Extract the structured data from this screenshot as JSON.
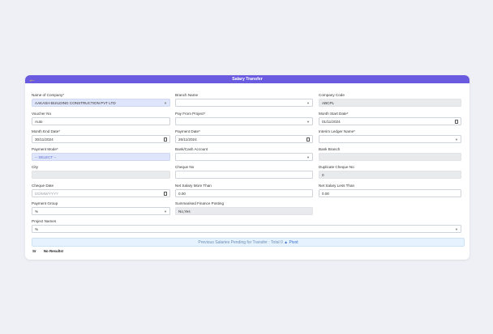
{
  "header": {
    "title": "Salary Transfer",
    "back_icon": "arrow-left-icon"
  },
  "fields": {
    "company": {
      "label": "Name of Company*",
      "value": "AAKASH BUILDING CONSTRUCTION PVT LTD"
    },
    "branch": {
      "label": "Branch Name",
      "value": ""
    },
    "company_code": {
      "label": "Company Code",
      "value": "ABCPL"
    },
    "voucher": {
      "label": "Voucher No",
      "value": "Auto"
    },
    "pay_from_project": {
      "label": "Pay From Project*",
      "value": ""
    },
    "month_start": {
      "label": "Month Start Date*",
      "value": "01/11/2024"
    },
    "month_end": {
      "label": "Month End Date*",
      "value": "30/11/2024"
    },
    "payment_date": {
      "label": "Payment Date*",
      "value": "26/11/2024"
    },
    "interim_ledger": {
      "label": "Interim Ledger Name*",
      "value": ""
    },
    "payment_mode": {
      "label": "Payment Mode*",
      "value": "-- SELECT --"
    },
    "bank_account": {
      "label": "Bank/Cash Account",
      "value": ""
    },
    "bank_branch": {
      "label": "Bank Branch",
      "value": ""
    },
    "city": {
      "label": "City",
      "value": ""
    },
    "cheque_no": {
      "label": "Cheque No",
      "value": ""
    },
    "duplicate_cheque": {
      "label": "Duplicate Cheque No",
      "value": "0"
    },
    "cheque_date": {
      "label": "Cheque Date",
      "placeholder": "DD/MM/YYYY"
    },
    "net_more": {
      "label": "Net Salary More Than",
      "value": "0.00"
    },
    "net_less": {
      "label": "Net Salary Less Than",
      "value": "0.00"
    },
    "payment_group": {
      "label": "Payment Group",
      "value": "%"
    },
    "summarised": {
      "label": "Summarised Finance Posting",
      "value": "No,Yes"
    },
    "project_names": {
      "label": "Project Names",
      "value": "%"
    }
  },
  "pending": {
    "text": "Previous Salaries Pending for Transfer : Total 0",
    "pivot_label": "Pivot"
  },
  "results": {
    "col_sr": "Sr",
    "no_results": "No Results!"
  }
}
